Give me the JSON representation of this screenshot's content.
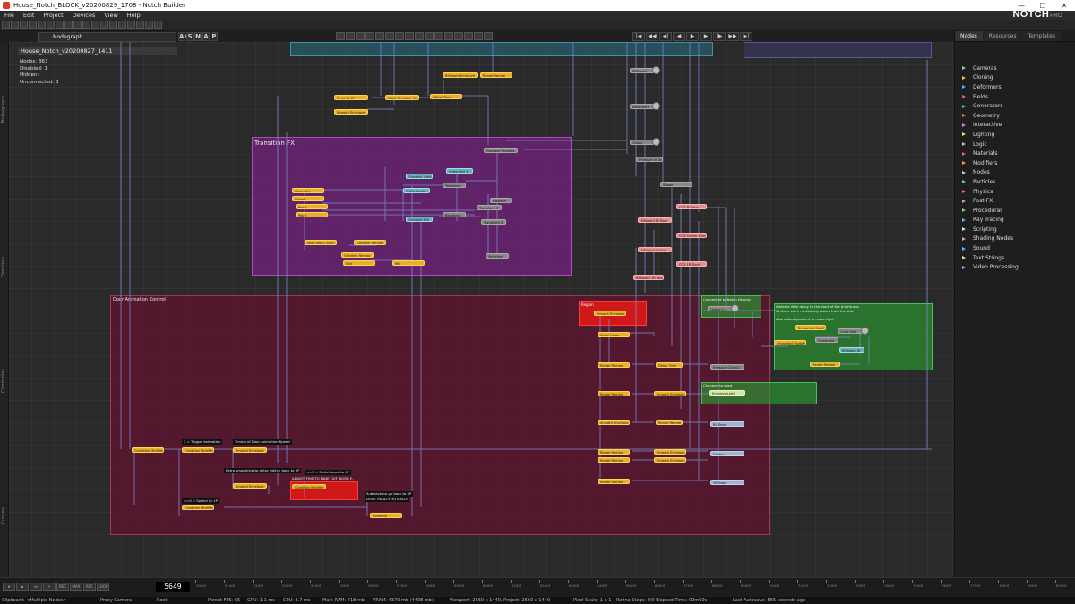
{
  "window": {
    "title": "House_Notch_BLOCK_v20200829_1708 - Notch Builder",
    "minimize": "—",
    "maximize": "☐",
    "close": "✕"
  },
  "menu": [
    "File",
    "Edit",
    "Project",
    "Devices",
    "View",
    "Help"
  ],
  "brand": {
    "name": "NOTCH",
    "edition": "PRO"
  },
  "toolbar2": {
    "tab_label": "Nodegraph",
    "mode_letters": [
      "AK",
      "S",
      "N",
      "A",
      "P"
    ]
  },
  "playback": [
    "|◀",
    "◀◀",
    "◀|",
    "◀",
    "▶",
    "▶",
    "|▶",
    "▶▶",
    "▶|"
  ],
  "side_labels": {
    "nodegraph": "Nodegraph",
    "timeline": "Timeline",
    "controller": "Controller",
    "curves": "Curves"
  },
  "nodegraph": {
    "document_title": "House_Notch_v20200827_1411",
    "stats": [
      "Nodes:  363",
      "Disabled:  1",
      "Hidden:",
      "Unconnected:  3"
    ]
  },
  "groups": {
    "transition_fx": "Transition  FX",
    "door_control": "Door Animation Control",
    "region": "Region"
  },
  "nodes": {
    "n01": "Billboard Emissive",
    "n02": "Range Remap",
    "n03": "1 cos to 4P",
    "n04": "Night Emissive lfo",
    "n05": "Offset Time",
    "n06": "Smooth Envelope",
    "n07": "Billboard",
    "n08": "Backboard",
    "n09": "Colour",
    "n10": "Gradient Shading",
    "n11": "Video Null 4",
    "n12": "Gradient Light",
    "n13": "Transform",
    "n14": "Video Loader",
    "n15": "Geometry",
    "n16": "Speed",
    "n17": "Pos X",
    "n18": "Pos Y",
    "n19": "Displace",
    "n20": "Gradient Mix",
    "n21": "Blending",
    "n22": "Transform 3",
    "n23": "Transform 4",
    "n24": "Wipe away (com..",
    "n25": "Gradient Remap",
    "n26": "Gradient Remap",
    "n27": "Add",
    "n28": "Mix",
    "n29": "Selection",
    "n30": "Shape",
    "n31": "CCB Bl Door",
    "n32": "Billboard Bl Door",
    "n33": "CCB Center Door",
    "n34": "Billboard Center",
    "n35": "CCB 1R Door",
    "n36": "Billboard 1R Door",
    "n37": "Smooth Envelope",
    "n38": "Linear Li...",
    "n39": "Video Video",
    "n40": "Range Remap",
    "n41": "Delay Time",
    "n42": "Emissive Colr Gr..",
    "n43": "Range Remap",
    "n44": "Smooth Envelope",
    "n45": "Emissive Light",
    "n46": "Smooth Envelope",
    "n47": "Range Remap",
    "n48": "BL Door",
    "n49": "Condition Modifier",
    "n50": "Condition Modifier",
    "n51": "Smooth Envelope",
    "n52": "Range Remap",
    "n53": "Smooth Envelope",
    "n54": "Range Remap",
    "n55": "Smooth Envelope",
    "n56": "Center",
    "n57": "Smooth Envelope",
    "n58": "Condition Modifier",
    "n59": "Range Remap",
    "n60": "1R Door",
    "n61": "Condition Modifier",
    "n62": "Combine",
    "n63": "Smoothed Modifier",
    "n64": "Color Shift",
    "n65": "Billboard Bl",
    "n66": "Smoothed Modifier",
    "n67": "Range Remap",
    "n68": "Constraint",
    "n69": "Emissive In Door"
  },
  "notes": {
    "c1": "2 = Trigger animation",
    "c2": "Timing of Door Animation Speed",
    "c3": "Extra smoothing to delay switch back to 0P",
    "c4": "<=0 = Switch back to 0P",
    "c5": "ADJUST THIS TO FADE OUT DOOR F..",
    "c6": "<=0 = Switch to 1P",
    "c7": "Subtracts to go back to 0P",
    "c8": "DONT READ VERTICALLY",
    "g1": "Connected to Notch Display",
    "g2": "Added a little delay to the start of the brightness",
    "g3": "so there were no aliasing issues from the side",
    "g4": "Also added gradient to move light",
    "g5": "Changed to sped"
  },
  "nodes_panel": {
    "tabs": [
      "Nodes",
      "Resources",
      "Templates"
    ],
    "categories": [
      {
        "name": "Cameras",
        "color": "#8bc3e8"
      },
      {
        "name": "Cloning",
        "color": "#e0c84a"
      },
      {
        "name": "Deformers",
        "color": "#5ab0ff"
      },
      {
        "name": "Fields",
        "color": "#e06070"
      },
      {
        "name": "Generators",
        "color": "#68c46a"
      },
      {
        "name": "Geometry",
        "color": "#e08a4a"
      },
      {
        "name": "Interactive",
        "color": "#b58adf"
      },
      {
        "name": "Lighting",
        "color": "#f0e060"
      },
      {
        "name": "Logic",
        "color": "#bbbbbb"
      },
      {
        "name": "Materials",
        "color": "#e46060"
      },
      {
        "name": "Modifiers",
        "color": "#e8b02a"
      },
      {
        "name": "Nodes",
        "color": "#cccccc"
      },
      {
        "name": "Particles",
        "color": "#5fd0c8"
      },
      {
        "name": "Physics",
        "color": "#c58a60"
      },
      {
        "name": "Post-FX",
        "color": "#e08ae0"
      },
      {
        "name": "Procedural",
        "color": "#7fd07a"
      },
      {
        "name": "Ray Tracing",
        "color": "#8a9ee0"
      },
      {
        "name": "Scripting",
        "color": "#dddddd"
      },
      {
        "name": "Shading Nodes",
        "color": "#e0a0a0"
      },
      {
        "name": "Sound",
        "color": "#5fb0ff"
      },
      {
        "name": "Text Strings",
        "color": "#e0e0a0"
      },
      {
        "name": "Video Processing",
        "color": "#7ac0e8"
      }
    ]
  },
  "timeline": {
    "current_frame": "5649",
    "buttons": [
      "⏺",
      "⏹",
      "⏭",
      "+",
      "REC",
      "MAX",
      "REC",
      "LOOP"
    ],
    "ticks": [
      "5000f",
      "5100f",
      "5200f",
      "5300f",
      "5400f",
      "5500f",
      "5600f",
      "5700f",
      "5800f",
      "5900f",
      "6000f",
      "6100f",
      "6200f",
      "6300f",
      "6400f",
      "6500f",
      "6600f",
      "6700f",
      "6800f",
      "6900f",
      "7000f",
      "7100f",
      "7200f",
      "7300f",
      "7400f",
      "7500f",
      "7600f",
      "7700f",
      "7800f",
      "7900f",
      "8000f"
    ]
  },
  "status": {
    "clipboard": "Clipboard: <Multiple Nodes>",
    "camera": "Proxy Camera",
    "root": "Root",
    "parent_fps": "Parent FPS: 65",
    "gpu": "GPU: 1.1 ms",
    "cpu": "CPU: 6.7 ms",
    "main_ram": "Main RAM: 718 mb",
    "vram": "VRAM: 4370 mb (4498 mb)",
    "viewport": "Viewport: 2560 x 1440, Project: 2560 x 1440",
    "pixel_scale": "Pixel Scale: 1 x 1",
    "refine": "Refine Steps: 0/0 Elapsed Time: 00m00s",
    "autosave": "Last Autosave: 565 seconds ago"
  }
}
